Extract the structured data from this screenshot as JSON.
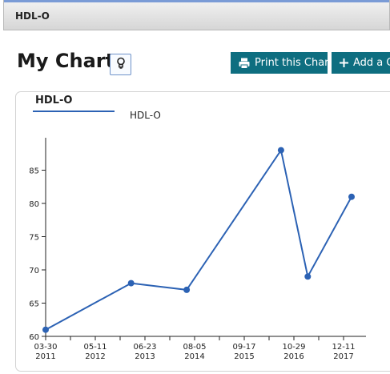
{
  "window": {
    "title": "HDL-O"
  },
  "page": {
    "heading": "My Charts"
  },
  "toolbar": {
    "print_label": "Print this Chart",
    "add_label": "Add a C",
    "tip_icon": "lightbulb-icon",
    "print_icon": "printer-icon",
    "add_icon": "plus-icon"
  },
  "chart_panel": {
    "tab_title": "HDL-O"
  },
  "colors": {
    "accent": "#0e6e80",
    "series": "#2c62b4"
  },
  "chart_data": {
    "type": "line",
    "title": "",
    "series": [
      {
        "name": "HDL-O",
        "x": [
          "2011-03-30",
          "2013-03-01",
          "2014-06-01",
          "2016-07-15",
          "2017-02-20",
          "2018-02-15"
        ],
        "values": [
          61,
          68,
          67,
          88,
          69,
          81
        ]
      }
    ],
    "ylim": [
      60,
      90
    ],
    "yticks": [
      60,
      65,
      70,
      75,
      80,
      85
    ],
    "xticks": [
      {
        "line1": "03-30",
        "line2": "2011"
      },
      {
        "line1": "05-11",
        "line2": "2012"
      },
      {
        "line1": "06-23",
        "line2": "2013"
      },
      {
        "line1": "08-05",
        "line2": "2014"
      },
      {
        "line1": "09-17",
        "line2": "2015"
      },
      {
        "line1": "10-29",
        "line2": "2016"
      },
      {
        "line1": "12-11",
        "line2": "2017"
      }
    ],
    "grid": false,
    "legend": "top-left"
  }
}
